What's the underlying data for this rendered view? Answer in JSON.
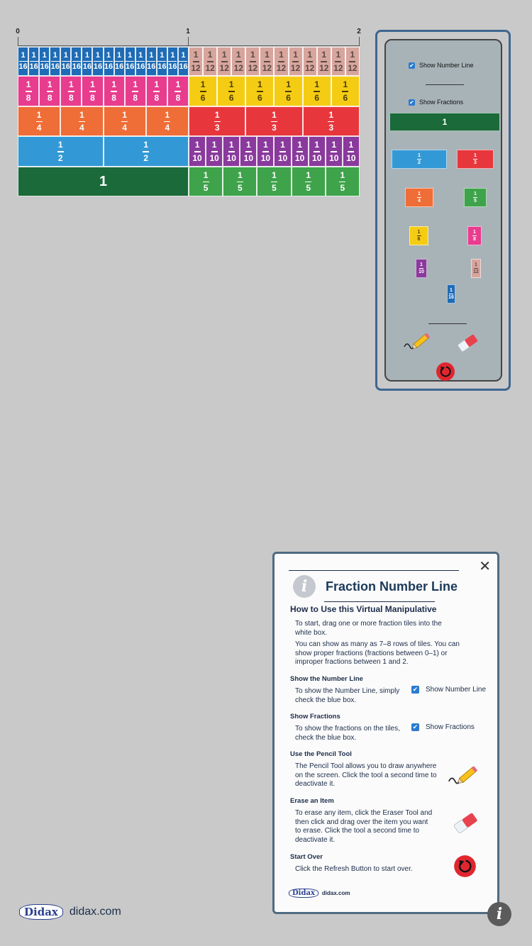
{
  "number_line": {
    "labels": [
      "0",
      "1",
      "2"
    ]
  },
  "tile_rows": [
    {
      "tiles": [
        {
          "n": "1",
          "d": "16",
          "color": "#1f6cb6",
          "kind": "t16",
          "count": 16
        },
        {
          "n": "1",
          "d": "12",
          "color": "#d8a59d",
          "kind": "t12",
          "count": 12
        }
      ]
    },
    {
      "tiles": [
        {
          "n": "1",
          "d": "8",
          "color": "#e83c8e",
          "kind": "t8",
          "count": 8
        },
        {
          "n": "1",
          "d": "6",
          "color": "#f5cc14",
          "kind": "t6",
          "count": 6
        }
      ]
    },
    {
      "tiles": [
        {
          "n": "1",
          "d": "4",
          "color": "#ef6d37",
          "kind": "t4",
          "count": 4
        },
        {
          "n": "1",
          "d": "3",
          "color": "#e8363d",
          "kind": "t3",
          "count": 3
        }
      ]
    },
    {
      "tiles": [
        {
          "n": "1",
          "d": "2",
          "color": "#3399d6",
          "kind": "t2",
          "count": 2
        },
        {
          "n": "1",
          "d": "10",
          "color": "#8a3a9c",
          "kind": "t10",
          "count": 10
        }
      ]
    },
    {
      "tiles": [
        {
          "n": "1",
          "d": "",
          "color": "#1a6a3a",
          "kind": "whole",
          "count": 1
        },
        {
          "n": "1",
          "d": "5",
          "color": "#3ea34a",
          "kind": "t5",
          "count": 5
        }
      ]
    }
  ],
  "panel": {
    "show_number_line": "Show Number Line",
    "show_fractions": "Show Fractions",
    "whole_label": "1",
    "tiles": [
      {
        "n": "1",
        "d": "2",
        "color": "#3399d6"
      },
      {
        "n": "1",
        "d": "3",
        "color": "#e8363d"
      },
      {
        "n": "1",
        "d": "4",
        "color": "#ef6d37"
      },
      {
        "n": "1",
        "d": "5",
        "color": "#3ea34a"
      },
      {
        "n": "1",
        "d": "6",
        "color": "#f5cc14"
      },
      {
        "n": "1",
        "d": "8",
        "color": "#e83c8e"
      },
      {
        "n": "1",
        "d": "10",
        "color": "#8a3a9c"
      },
      {
        "n": "1",
        "d": "12",
        "color": "#d8a59d"
      },
      {
        "n": "1",
        "d": "16",
        "color": "#1f6cb6"
      }
    ],
    "tools": [
      "pencil-icon",
      "eraser-icon",
      "refresh-icon"
    ]
  },
  "dialog": {
    "title": "Fraction Number Line",
    "subtitle": "How to Use this Virtual Manipulative",
    "intro1_line1": "To start, drag one or more fraction tiles into the",
    "intro1_line2": "white box.",
    "intro2_line1": "You can show as many as 7–8 rows of tiles. You can",
    "intro2_line2": "show proper fractions (fractions between 0–1) or",
    "intro2_line3": "improper fractions between 1 and 2.",
    "sections": {
      "number_line": {
        "heading": "Show the Number Line",
        "line1": "To show the Number Line, simply",
        "line2": "check the blue box.",
        "sample": "Show Number Line"
      },
      "fractions": {
        "heading": "Show Fractions",
        "line1": "To show the fractions on the tiles,",
        "line2": "check the blue box.",
        "sample": "Show Fractions"
      },
      "pencil": {
        "heading": "Use the Pencil Tool",
        "line1": "The Pencil Tool allows you to draw anywhere",
        "line2": "on the screen. Click the tool a second time to",
        "line3": "deactivate it."
      },
      "eraser": {
        "heading": "Erase an Item",
        "line1": "To erase any item, click the Eraser Tool and",
        "line2": "then click and drag over the item you want",
        "line3": "to erase. Click the tool a second time to",
        "line4": "deactivate it."
      },
      "start_over": {
        "heading": "Start Over",
        "line1": "Click the Refresh Button to start over."
      }
    },
    "footer_logo": "Didax",
    "footer_site": "didax.com"
  },
  "brand": {
    "logo": "Didax",
    "site": "didax.com"
  },
  "colors": {
    "accent": "#3f6690",
    "background": "#c9c9c9",
    "panel": "#a8b3b8",
    "whole_green": "#1a6a3a"
  }
}
